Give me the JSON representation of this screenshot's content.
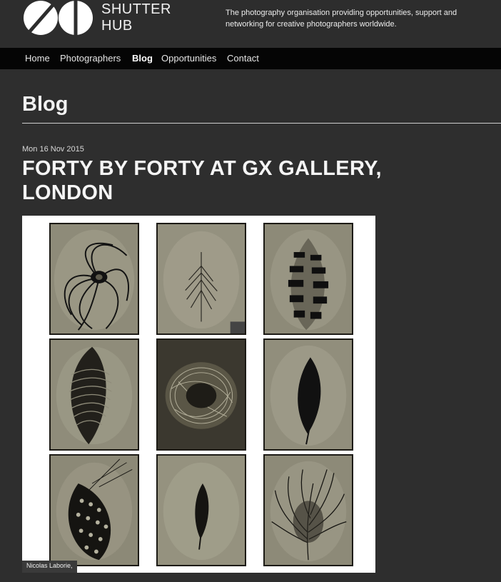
{
  "header": {
    "brand_line1": "SHUTTER",
    "brand_line2": "HUB",
    "tagline": "The photography organisation providing opportunities, support and networking for creative photographers worldwide."
  },
  "nav": {
    "items": [
      {
        "label": "Home"
      },
      {
        "label": "Photographers"
      },
      {
        "label": "Blog"
      },
      {
        "label": "Opportunities"
      },
      {
        "label": "Contact"
      }
    ],
    "active": "Blog"
  },
  "page": {
    "section_title": "Blog"
  },
  "post": {
    "date": "Mon 16 Nov 2015",
    "title": "FORTY BY FORTY AT GX GALLERY, LONDON",
    "image_caption": "Nicolas Laborie,",
    "plates": [
      {
        "subject": "peacock-feather"
      },
      {
        "subject": "faint-feather"
      },
      {
        "subject": "barred-feather"
      },
      {
        "subject": "striped-feather"
      },
      {
        "subject": "nest"
      },
      {
        "subject": "dark-feather"
      },
      {
        "subject": "spotted-feather"
      },
      {
        "subject": "small-feather"
      },
      {
        "subject": "plume-feather"
      }
    ]
  },
  "colors": {
    "background": "#2e2e2e",
    "nav_background": "#050505",
    "text": "#ffffff",
    "plate_tone": "#8f8c7b"
  }
}
